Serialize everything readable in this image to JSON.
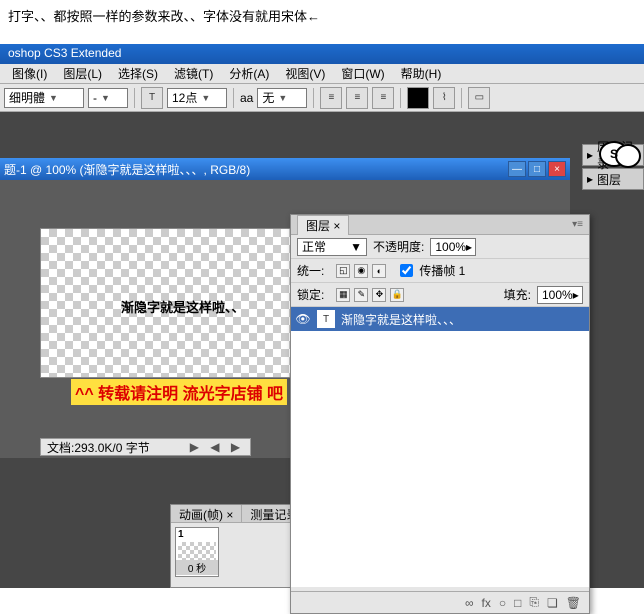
{
  "note": "打字、、都按照一样的参数来改、、字体没有就用宋体←",
  "app_title": "oshop CS3 Extended",
  "menu": [
    "图像(I)",
    "图层(L)",
    "选择(S)",
    "滤镜(T)",
    "分析(A)",
    "视图(V)",
    "窗口(W)",
    "帮助(H)"
  ],
  "toolbar": {
    "font_family": "细明體",
    "font_style": "-",
    "font_size": "12点",
    "aa_label": "aa",
    "aa_value": "无"
  },
  "doc": {
    "title": "题-1 @ 100% (渐隐字就是这样啦、、、, RGB/8)",
    "canvas_text": "渐隐字就是这样啦、、",
    "overlay": "^^ 转载请注明  流光字店铺   吧",
    "status": "文档:293.0K/0 字节"
  },
  "layers": {
    "tab": "图层 ×",
    "blend": "正常",
    "opacity_label": "不透明度:",
    "opacity": "100%",
    "unify_label": "统一:",
    "propagate": "传播帧 1",
    "lock_label": "锁定:",
    "fill_label": "填充:",
    "fill": "100%",
    "item": "渐隐字就是这样啦、、、",
    "footer_icons": [
      "∞",
      "fx",
      "○",
      "□",
      "⎘",
      "❏",
      "🗑"
    ]
  },
  "side": {
    "history": "历史记录",
    "layers": "图层"
  },
  "anim": {
    "tabs": [
      "动画(帧) ×",
      "测量记录"
    ],
    "frame_num": "1",
    "frame_time": "0 秒"
  }
}
